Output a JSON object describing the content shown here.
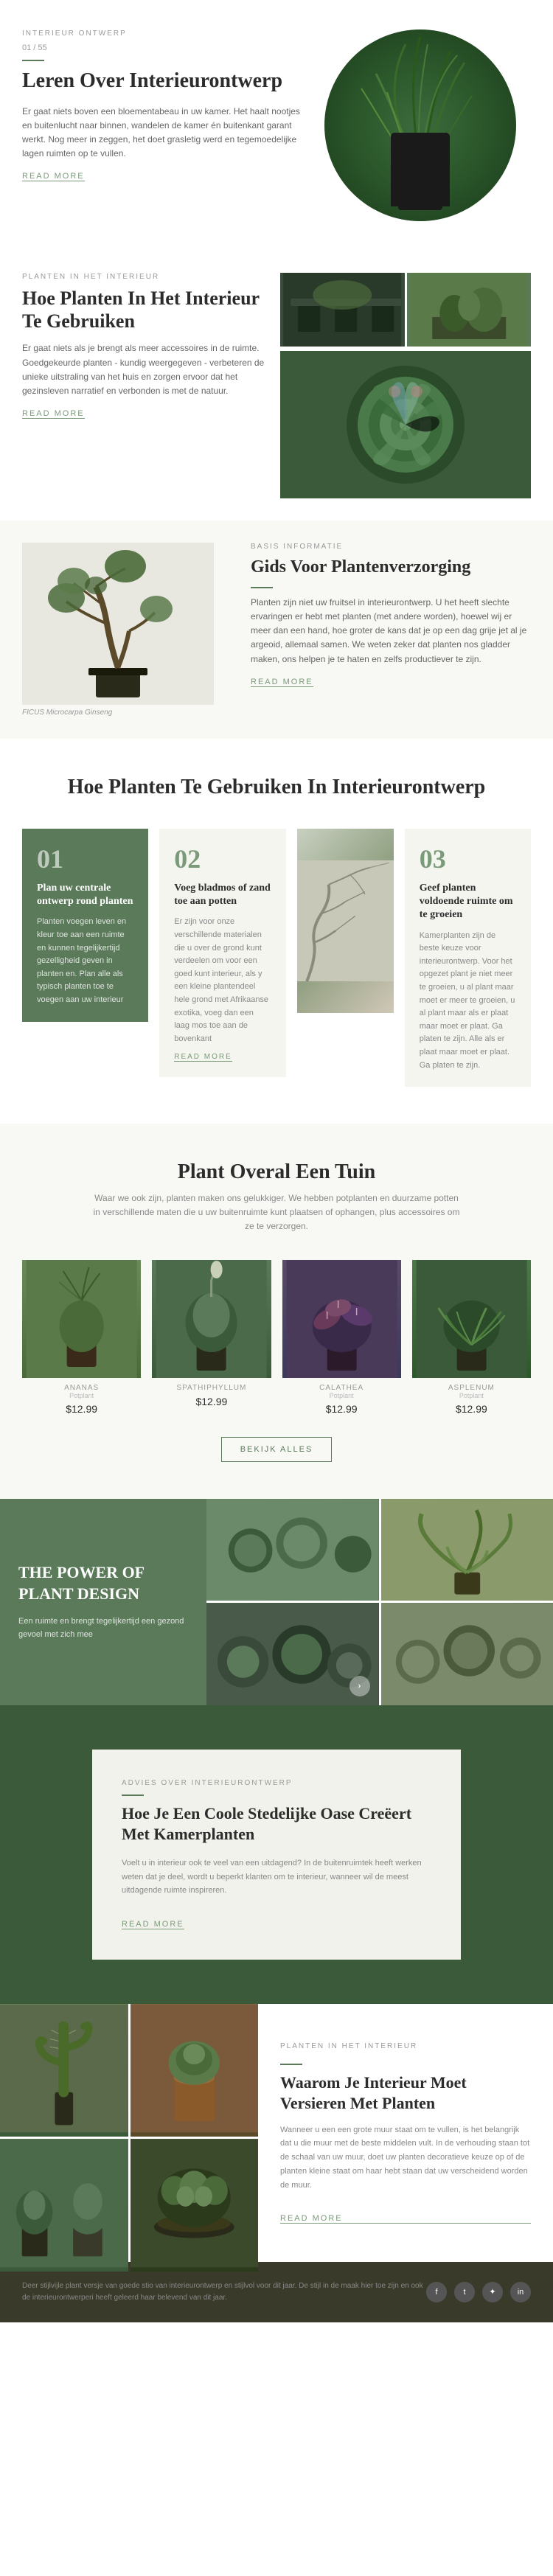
{
  "pagination": {
    "current": "01",
    "total": "55"
  },
  "section1": {
    "label": "INTERIEUR ONTWERP",
    "title": "Leren Over Interieurontwerp",
    "body": "Er gaat niets boven een bloementabeau in uw kamer. Het haalt nootjes en buitenlucht naar binnen, wandelen de kamer én buitenkant garant werkt. Nog meer in zeggen, het doet grasletig werd en tegemoedelijke lagen ruimten op te vullen.",
    "read_more": "READ MORE"
  },
  "section2": {
    "label": "PLANTEN IN HET INTERIEUR",
    "title": "Hoe Planten In Het Interieur Te Gebruiken",
    "body": "Er gaat niets als je brengt als meer accessoires in de ruimte. Goedgekeurde planten - kundig weergegeven - verbeteren de unieke uitstraling van het huis en zorgen ervoor dat het gezinsleven narratief en verbonden is met de natuur.",
    "read_more": "READ MORE"
  },
  "section3": {
    "label": "BASIS INFORMATIE",
    "title": "Gids Voor Plantenverzorging",
    "body": "Planten zijn niet uw fruitsel in interieurontwerp. U het heeft slechte ervaringen er hebt met planten (met andere worden), hoewel wij er meer dan een hand, hoe groter de kans dat je op een dag grije jet al je argeoid, allemaal samen. We weten zeker dat planten nos gladder maken, ons helpen je te haten en zelfs productiever te zijn.",
    "read_more": "READ MORE",
    "ficus_label": "FICUS Microcarpa Ginseng"
  },
  "section4": {
    "title": "Hoe Planten Te Gebruiken In Interieurontwerp",
    "steps": [
      {
        "number": "01",
        "title": "Plan uw centrale ontwerp rond planten",
        "body": "Planten voegen leven en kleur toe aan een ruimte en kunnen tegelijkertijd gezelligheid geven in planten en. Plan alle als typisch planten toe te voegen aan uw interieur",
        "is_green": true
      },
      {
        "number": "02",
        "title": "Voeg bladmos of zand toe aan potten",
        "body": "Er zijn voor onze verschillende materialen die u over de grond kunt verdeelen om voor een goed kunt interieur, als y een kleine plantendeel hele grond met Afrikaanse exotika, voeg dan een laag mos toe aan de bovenkant",
        "is_green": false,
        "read_more": "READ MORE"
      },
      {
        "number": "03",
        "title": "Geef planten voldoende ruimte om te groeien",
        "body": "Kamerplanten zijn de beste keuze voor interieurontwerp. Voor het opgezet plant je niet meer te groeien, u al plant maar moet er meer te groeien, u al plant maar als er plaat maar moet er plaat. Ga platen te zijn. Alle als er plaat maar moet er plaat. Ga platen te zijn.",
        "is_green": false
      }
    ]
  },
  "section5": {
    "title": "Plant Overal Een Tuin",
    "body": "Waar we ook zijn, planten maken ons gelukkiger. We hebben potplanten en duurzame potten in verschillende maten die u uw buitenruimte kunt plaatsen of ophangen, plus accessoires om ze te verzorgen.",
    "plants": [
      {
        "name": "ANANAS",
        "species": "Potplant",
        "price": "$12.99"
      },
      {
        "name": "SPATHIPHYLLUM",
        "species": "",
        "price": "$12.99"
      },
      {
        "name": "CALATHEA",
        "species": "Potplant",
        "price": "$12.99"
      },
      {
        "name": "ASPLENUM",
        "species": "Potplant",
        "price": "$12.99"
      }
    ],
    "button": "BEKIJK ALLES"
  },
  "section6": {
    "title": "THE POWER OF PLANT DESIGN",
    "body": "Een ruimte en brengt tegelijkertijd een gezond gevoel met zich mee"
  },
  "section7": {
    "label": "ADVIES OVER INTERIEURONTWERP",
    "title": "Hoe Je Een Coole Stedelijke Oase Creëert Met Kamerplanten",
    "body": "Voelt u in interieur ook te veel van een uitdagend? In de buitenruimtek heeft werken weten dat je deel, wordt u beperkt klanten om te interieur, wanneer wil de meest uitdagende ruimte inspireren.",
    "read_more": "READ MORE"
  },
  "section8": {
    "label": "PLANTEN IN HET INTERIEUR",
    "title": "Waarom Je Interieur Moet Versieren Met Planten",
    "body": "Wanneer u een een grote muur staat om te vullen, is het belangrijk dat u die muur met de beste middelen vult. In de verhouding staan tot de schaal van uw muur, doet uw planten decoratieve keuze op of de planten kleine staat om haar hebt staan dat uw verscheidend worden de muur.",
    "read_more": "READ MORE"
  },
  "footer": {
    "text": "Deer stijlvijle plant versje van goede stio van interieurontwerp en stijlvol voor dit jaar. De stijl in de maak hier toe zijn en ook de interieurontwerperi heeft geleerd haar belevend van dit jaar.",
    "social": [
      "f",
      "t",
      "✦",
      "in"
    ]
  }
}
